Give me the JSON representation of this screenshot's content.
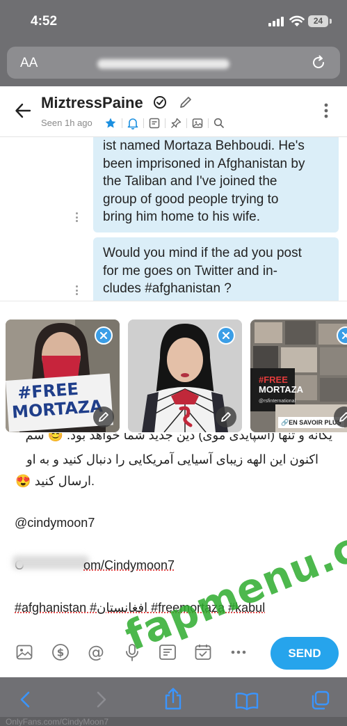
{
  "status_bar": {
    "time": "4:52",
    "battery": "24"
  },
  "browser": {
    "text_size_label": "AA"
  },
  "header": {
    "username": "MiztressPaine",
    "seen": "Seen 1h ago"
  },
  "messages": [
    {
      "lines": [
        "ist named Mortaza Behboudi. He's",
        "been imprisoned in Afghanistan by",
        "the Taliban and I've joined the",
        "group of good people trying to",
        "bring him home to his wife."
      ]
    },
    {
      "lines": [
        "Would you mind if the ad you post",
        "for me goes on Twitter and in-",
        "cludes #afghanistan ?"
      ]
    }
  ],
  "media": [
    {
      "sign_text_1": "#FREE",
      "sign_text_2": "MORTAZA"
    },
    {},
    {
      "headline_1": "#FREE",
      "headline_2": "MORTAZA",
      "source": "@rsfinternational",
      "cta": "EN SAVOIR PLUS"
    }
  ],
  "composer": {
    "line_partial": "یگانه و تنها (اسپایدی موی) دین جدید شما خواهد بود. 😊 سم",
    "line1": "اکنون این الهه زیبای آسیایی آمریکایی را دنبال کنید و به او",
    "line2": ".ارسال کنید 😍",
    "mention": "@cindymoon7",
    "link_suffix": "om/Cindymoon7",
    "link_prefix": "O",
    "hashtags": "#afghanistan #افغانستان #freemortaza #kabul"
  },
  "toolbar": {
    "send_label": "SEND"
  },
  "bottom_strip": "OnlyFans.com/CindyMoon7",
  "watermark": "fapmenu.com",
  "colors": {
    "accent": "#26a4ec",
    "bubble": "#dbeef8",
    "watermark": "#2eac2e"
  }
}
